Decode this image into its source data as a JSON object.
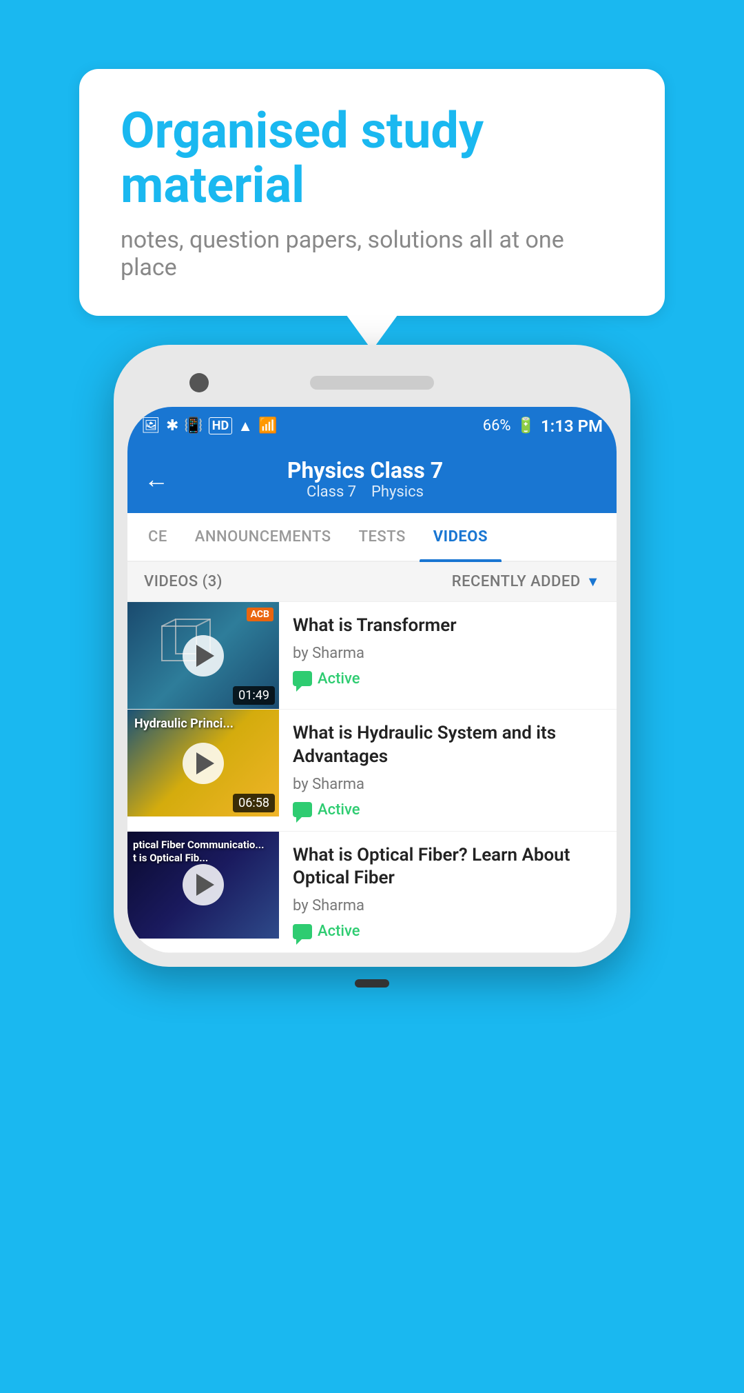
{
  "background_color": "#1ab8f0",
  "speech_bubble": {
    "title": "Organised study material",
    "subtitle": "notes, question papers, solutions all at one place"
  },
  "phone": {
    "status_bar": {
      "time": "1:13 PM",
      "battery": "66%",
      "signal_icons": "HD"
    },
    "header": {
      "back_label": "←",
      "title": "Physics Class 7",
      "subtitle_class": "Class 7",
      "subtitle_subject": "Physics"
    },
    "tabs": [
      {
        "label": "CE",
        "active": false
      },
      {
        "label": "ANNOUNCEMENTS",
        "active": false
      },
      {
        "label": "TESTS",
        "active": false
      },
      {
        "label": "VIDEOS",
        "active": true
      }
    ],
    "filter_bar": {
      "count_label": "VIDEOS (3)",
      "sort_label": "RECENTLY ADDED"
    },
    "videos": [
      {
        "title": "What is  Transformer",
        "author": "by Sharma",
        "status": "Active",
        "duration": "01:49",
        "thumb_type": "transformer"
      },
      {
        "title": "What is Hydraulic System and its Advantages",
        "author": "by Sharma",
        "status": "Active",
        "duration": "06:58",
        "thumb_type": "hydraulic"
      },
      {
        "title": "What is Optical Fiber? Learn About Optical Fiber",
        "author": "by Sharma",
        "status": "Active",
        "duration": "",
        "thumb_type": "optical"
      }
    ]
  }
}
